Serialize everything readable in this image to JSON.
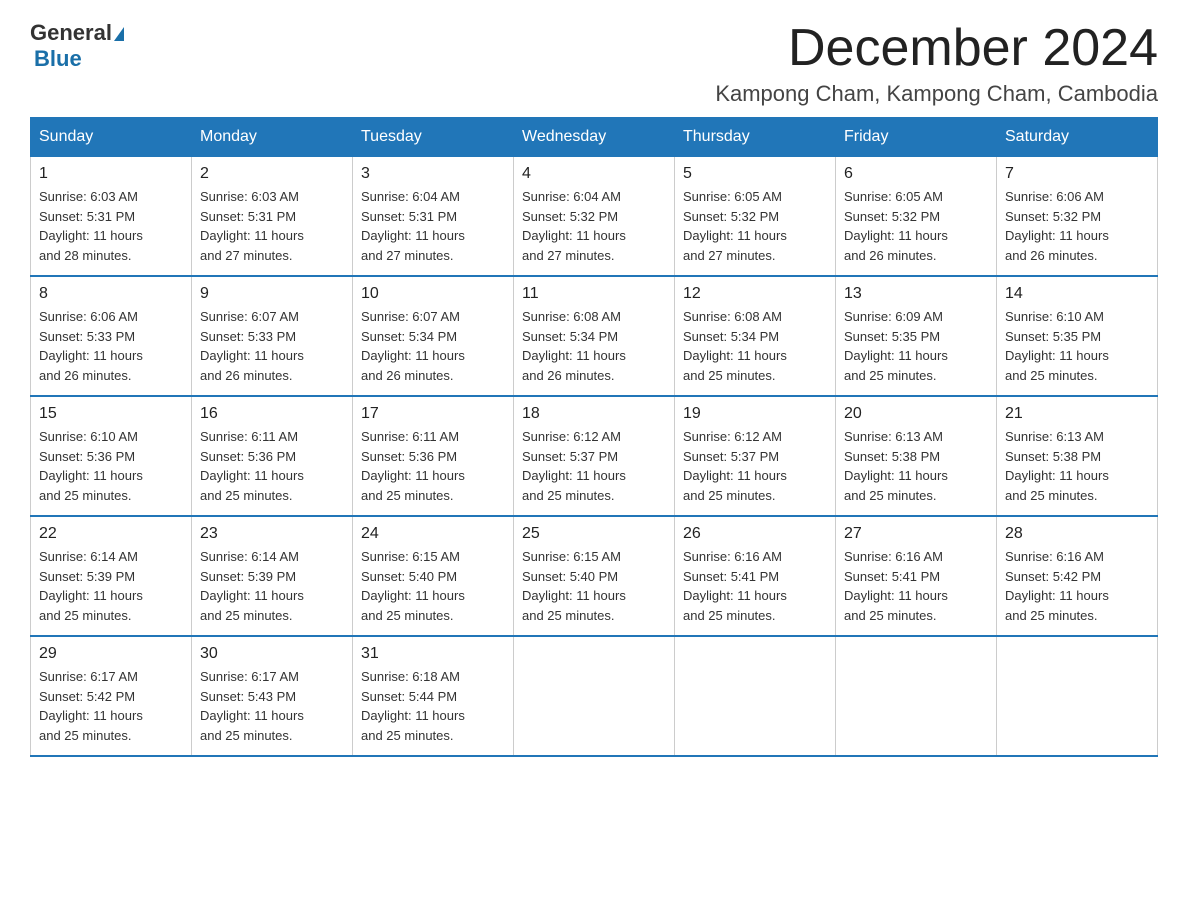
{
  "header": {
    "logo_general": "General",
    "logo_blue": "Blue",
    "month_title": "December 2024",
    "location": "Kampong Cham, Kampong Cham, Cambodia"
  },
  "days_of_week": [
    "Sunday",
    "Monday",
    "Tuesday",
    "Wednesday",
    "Thursday",
    "Friday",
    "Saturday"
  ],
  "weeks": [
    [
      {
        "day": "1",
        "sunrise": "6:03 AM",
        "sunset": "5:31 PM",
        "daylight": "11 hours and 28 minutes."
      },
      {
        "day": "2",
        "sunrise": "6:03 AM",
        "sunset": "5:31 PM",
        "daylight": "11 hours and 27 minutes."
      },
      {
        "day": "3",
        "sunrise": "6:04 AM",
        "sunset": "5:31 PM",
        "daylight": "11 hours and 27 minutes."
      },
      {
        "day": "4",
        "sunrise": "6:04 AM",
        "sunset": "5:32 PM",
        "daylight": "11 hours and 27 minutes."
      },
      {
        "day": "5",
        "sunrise": "6:05 AM",
        "sunset": "5:32 PM",
        "daylight": "11 hours and 27 minutes."
      },
      {
        "day": "6",
        "sunrise": "6:05 AM",
        "sunset": "5:32 PM",
        "daylight": "11 hours and 26 minutes."
      },
      {
        "day": "7",
        "sunrise": "6:06 AM",
        "sunset": "5:32 PM",
        "daylight": "11 hours and 26 minutes."
      }
    ],
    [
      {
        "day": "8",
        "sunrise": "6:06 AM",
        "sunset": "5:33 PM",
        "daylight": "11 hours and 26 minutes."
      },
      {
        "day": "9",
        "sunrise": "6:07 AM",
        "sunset": "5:33 PM",
        "daylight": "11 hours and 26 minutes."
      },
      {
        "day": "10",
        "sunrise": "6:07 AM",
        "sunset": "5:34 PM",
        "daylight": "11 hours and 26 minutes."
      },
      {
        "day": "11",
        "sunrise": "6:08 AM",
        "sunset": "5:34 PM",
        "daylight": "11 hours and 26 minutes."
      },
      {
        "day": "12",
        "sunrise": "6:08 AM",
        "sunset": "5:34 PM",
        "daylight": "11 hours and 25 minutes."
      },
      {
        "day": "13",
        "sunrise": "6:09 AM",
        "sunset": "5:35 PM",
        "daylight": "11 hours and 25 minutes."
      },
      {
        "day": "14",
        "sunrise": "6:10 AM",
        "sunset": "5:35 PM",
        "daylight": "11 hours and 25 minutes."
      }
    ],
    [
      {
        "day": "15",
        "sunrise": "6:10 AM",
        "sunset": "5:36 PM",
        "daylight": "11 hours and 25 minutes."
      },
      {
        "day": "16",
        "sunrise": "6:11 AM",
        "sunset": "5:36 PM",
        "daylight": "11 hours and 25 minutes."
      },
      {
        "day": "17",
        "sunrise": "6:11 AM",
        "sunset": "5:36 PM",
        "daylight": "11 hours and 25 minutes."
      },
      {
        "day": "18",
        "sunrise": "6:12 AM",
        "sunset": "5:37 PM",
        "daylight": "11 hours and 25 minutes."
      },
      {
        "day": "19",
        "sunrise": "6:12 AM",
        "sunset": "5:37 PM",
        "daylight": "11 hours and 25 minutes."
      },
      {
        "day": "20",
        "sunrise": "6:13 AM",
        "sunset": "5:38 PM",
        "daylight": "11 hours and 25 minutes."
      },
      {
        "day": "21",
        "sunrise": "6:13 AM",
        "sunset": "5:38 PM",
        "daylight": "11 hours and 25 minutes."
      }
    ],
    [
      {
        "day": "22",
        "sunrise": "6:14 AM",
        "sunset": "5:39 PM",
        "daylight": "11 hours and 25 minutes."
      },
      {
        "day": "23",
        "sunrise": "6:14 AM",
        "sunset": "5:39 PM",
        "daylight": "11 hours and 25 minutes."
      },
      {
        "day": "24",
        "sunrise": "6:15 AM",
        "sunset": "5:40 PM",
        "daylight": "11 hours and 25 minutes."
      },
      {
        "day": "25",
        "sunrise": "6:15 AM",
        "sunset": "5:40 PM",
        "daylight": "11 hours and 25 minutes."
      },
      {
        "day": "26",
        "sunrise": "6:16 AM",
        "sunset": "5:41 PM",
        "daylight": "11 hours and 25 minutes."
      },
      {
        "day": "27",
        "sunrise": "6:16 AM",
        "sunset": "5:41 PM",
        "daylight": "11 hours and 25 minutes."
      },
      {
        "day": "28",
        "sunrise": "6:16 AM",
        "sunset": "5:42 PM",
        "daylight": "11 hours and 25 minutes."
      }
    ],
    [
      {
        "day": "29",
        "sunrise": "6:17 AM",
        "sunset": "5:42 PM",
        "daylight": "11 hours and 25 minutes."
      },
      {
        "day": "30",
        "sunrise": "6:17 AM",
        "sunset": "5:43 PM",
        "daylight": "11 hours and 25 minutes."
      },
      {
        "day": "31",
        "sunrise": "6:18 AM",
        "sunset": "5:44 PM",
        "daylight": "11 hours and 25 minutes."
      },
      null,
      null,
      null,
      null
    ]
  ],
  "labels": {
    "sunrise": "Sunrise:",
    "sunset": "Sunset:",
    "daylight": "Daylight:"
  }
}
